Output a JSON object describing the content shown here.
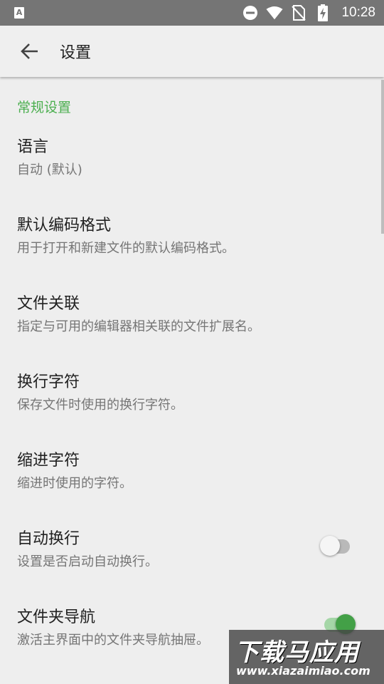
{
  "status_bar": {
    "time": "10:28",
    "app_icon_letter": "A",
    "icons": [
      "do-not-disturb-icon",
      "wifi-icon",
      "no-sim-icon",
      "battery-charging-icon"
    ]
  },
  "app_bar": {
    "title": "设置",
    "back_icon": "arrow-back-icon"
  },
  "section": {
    "header": "常规设置"
  },
  "items": [
    {
      "title": "语言",
      "subtitle": "自动 (默认)"
    },
    {
      "title": "默认编码格式",
      "subtitle": "用于打开和新建文件的默认编码格式。"
    },
    {
      "title": "文件关联",
      "subtitle": "指定与可用的编辑器相关联的文件扩展名。"
    },
    {
      "title": "换行字符",
      "subtitle": "保存文件时使用的换行字符。"
    },
    {
      "title": "缩进字符",
      "subtitle": "缩进时使用的字符。"
    },
    {
      "title": "自动换行",
      "subtitle": "设置是否启动自动换行。",
      "switch_on": false
    },
    {
      "title": "文件夹导航",
      "subtitle": "激活主界面中的文件夹导航抽屉。",
      "switch_on": true
    }
  ],
  "colors": {
    "accent": "#4caf50",
    "status_bar": "#757575",
    "background": "#eeeeee"
  },
  "watermark": {
    "main": "下载马应用",
    "url": "www.xiazaimiao.com"
  }
}
